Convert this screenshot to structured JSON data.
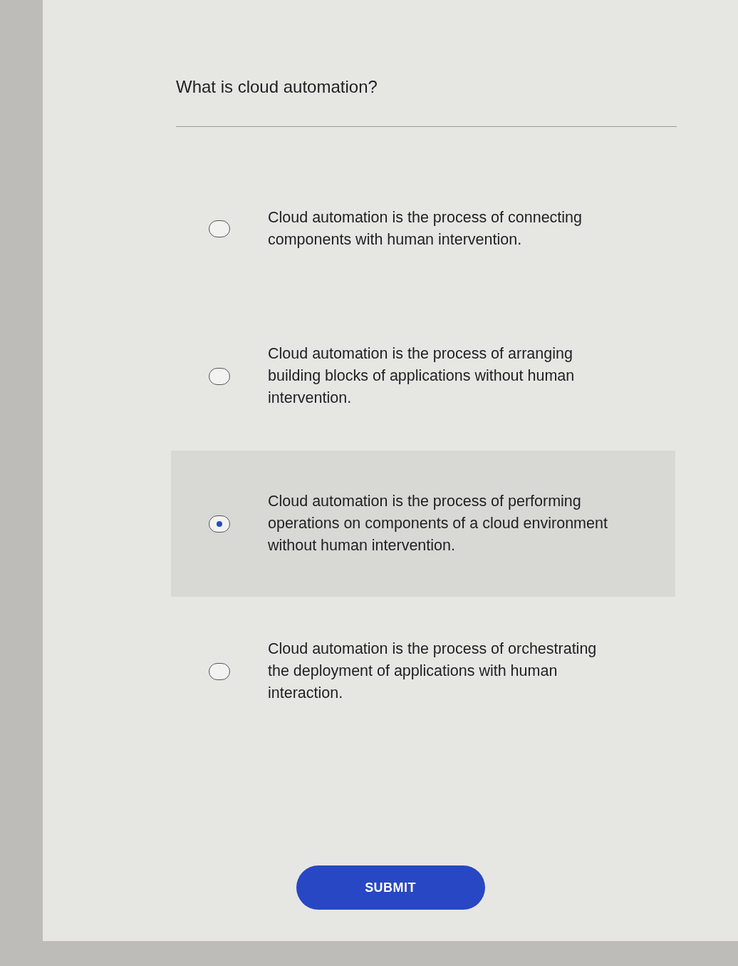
{
  "question": "What is cloud automation?",
  "options": [
    {
      "text": "Cloud automation is the process of connecting components with human intervention.",
      "selected": false
    },
    {
      "text": "Cloud automation is the process of arranging building blocks of applications without human intervention.",
      "selected": false
    },
    {
      "text": "Cloud automation is the process of performing operations on components of a cloud environment without human intervention.",
      "selected": true
    },
    {
      "text": "Cloud automation is the process of orchestrating the deployment of applications with human interaction.",
      "selected": false
    }
  ],
  "submit": "SUBMIT"
}
